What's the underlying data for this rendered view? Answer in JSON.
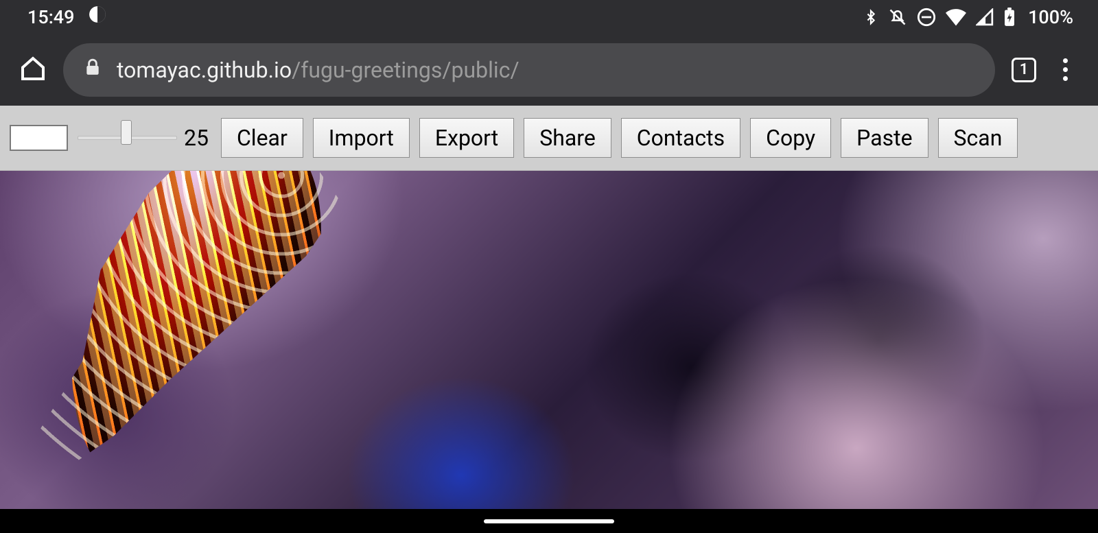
{
  "status": {
    "time": "15:49",
    "battery_pct": "100%"
  },
  "browser": {
    "url_host": "tomayac.github.io",
    "url_path": "/fugu-greetings/public/",
    "tab_count": "1"
  },
  "toolbar": {
    "slider_value": "25",
    "buttons": {
      "clear": "Clear",
      "import": "Import",
      "export": "Export",
      "share": "Share",
      "contacts": "Contacts",
      "copy": "Copy",
      "paste": "Paste",
      "scan": "Scan"
    }
  }
}
